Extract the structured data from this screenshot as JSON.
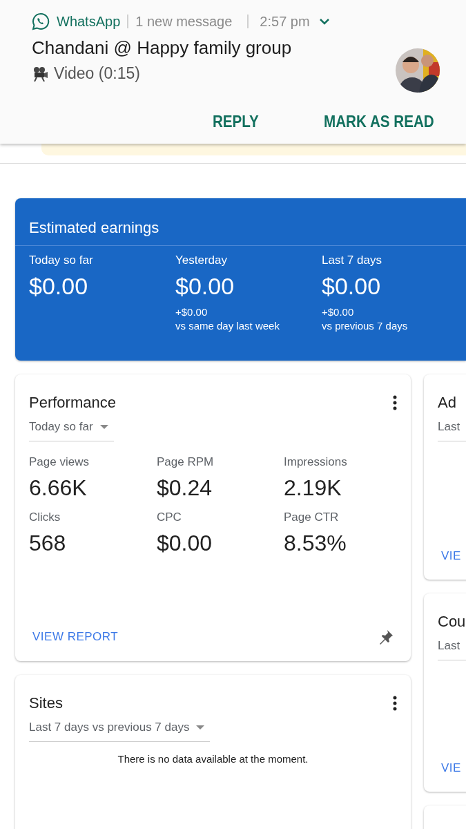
{
  "notification": {
    "app": "WhatsApp",
    "summary": "1 new message",
    "time": "2:57 pm",
    "title": "Chandani @ Happy family group",
    "body": "Video (0:15)",
    "avatar": {
      "kind": "picture"
    },
    "actions": [
      "REPLY",
      "MARK AS READ"
    ]
  },
  "earnings": {
    "title": "Estimated earnings",
    "items": [
      {
        "label": "Today so far",
        "value": "$0.00"
      },
      {
        "label": "Yesterday",
        "value": "$0.00",
        "delta": "+$0.00",
        "compare": "vs same day last week"
      },
      {
        "label": "Last 7 days",
        "value": "$0.00",
        "delta": "+$0.00",
        "compare": "vs previous 7 days"
      }
    ]
  },
  "performance": {
    "title": "Performance",
    "range": "Today so far",
    "metrics": [
      {
        "label": "Page views",
        "value": "6.66K"
      },
      {
        "label": "Page RPM",
        "value": "$0.24"
      },
      {
        "label": "Impressions",
        "value": "2.19K"
      },
      {
        "label": "Clicks",
        "value": "568"
      },
      {
        "label": "CPC",
        "value": "$0.00"
      },
      {
        "label": "Page CTR",
        "value": "8.53%"
      }
    ],
    "link": "VIEW REPORT"
  },
  "sites": {
    "title": "Sites",
    "range": "Last 7 days vs previous 7 days",
    "message": "There is no data available at the moment."
  },
  "side_cards": [
    {
      "kind": "report",
      "title": "Ad",
      "range": "Last",
      "link": "VIE"
    },
    {
      "kind": "report",
      "title": "Cou",
      "range": "Last",
      "link": "VIE"
    },
    {
      "kind": "empty"
    }
  ]
}
